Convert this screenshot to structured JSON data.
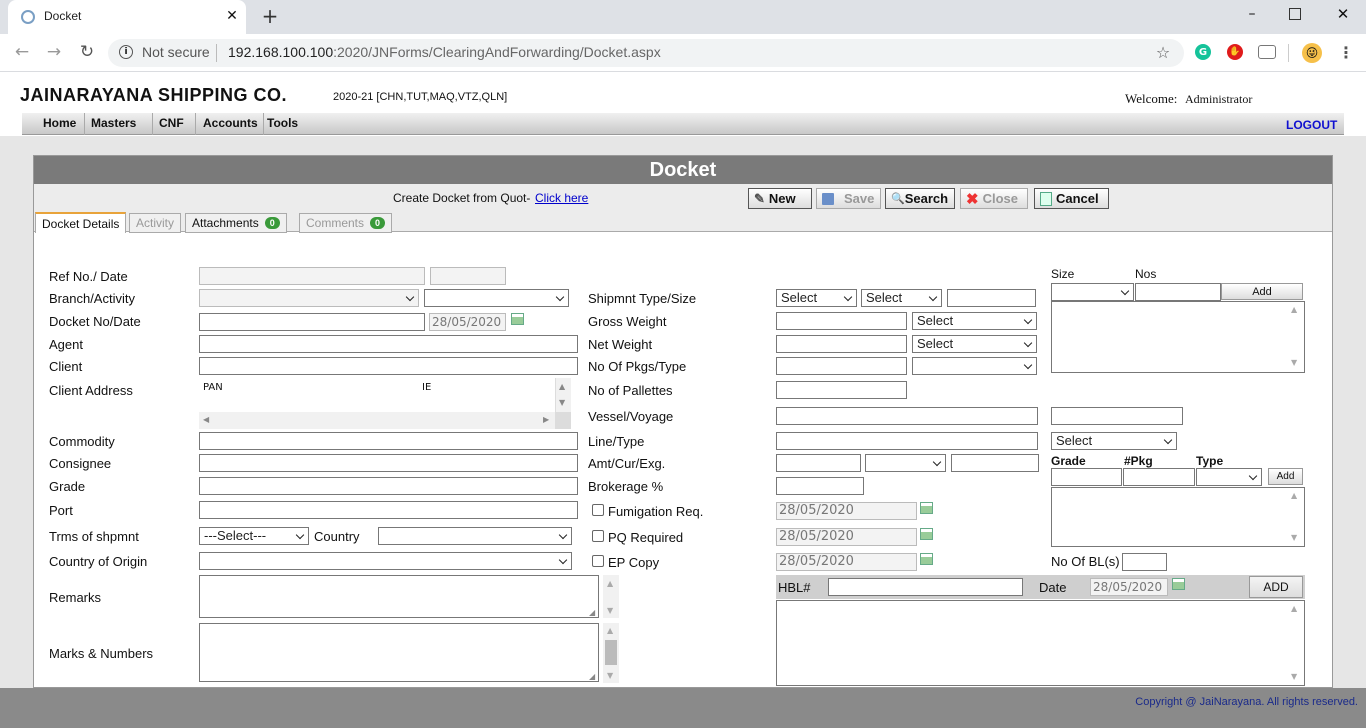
{
  "browser": {
    "tab_title": "Docket",
    "security_label": "Not secure",
    "url_host": "192.168.100.100",
    "url_path": ":2020/JNForms/ClearingAndForwarding/Docket.aspx"
  },
  "header": {
    "company": "JAINARAYANA SHIPPING CO.",
    "year_info": "2020-21 [CHN,TUT,MAQ,VTZ,QLN]",
    "welcome_label": "Welcome:",
    "user": "Administrator",
    "logout": "LOGOUT"
  },
  "menu": [
    "Home",
    "Masters",
    "CNF",
    "Accounts",
    "Tools"
  ],
  "panel_title": "Docket",
  "toolbar": {
    "create_text": "Create Docket from Quot-",
    "create_link": "Click here",
    "new": "New",
    "save": "Save",
    "search": "Search",
    "close": "Close",
    "cancel": "Cancel"
  },
  "tabs": {
    "details": "Docket Details",
    "activity": "Activity",
    "attachments": "Attachments",
    "attachments_count": "0",
    "comments": "Comments",
    "comments_count": "0"
  },
  "form": {
    "ref_no_date": "Ref No./ Date",
    "branch_activity": "Branch/Activity",
    "docket_no_date": "Docket No/Date",
    "docket_date": "28/05/2020",
    "agent": "Agent",
    "client": "Client",
    "client_address": "Client Address",
    "pan": "PAN",
    "ie": "IE",
    "commodity": "Commodity",
    "consignee": "Consignee",
    "grade": "Grade",
    "port": "Port",
    "terms_of_shipment": "Trms of shpmnt",
    "terms_select": "---Select---",
    "country": "Country",
    "country_of_origin": "Country of Origin",
    "remarks": "Remarks",
    "marks_numbers": "Marks & Numbers",
    "shipment_type_size": "Shipmnt Type/Size",
    "select": "Select",
    "gross_weight": "Gross Weight",
    "net_weight": "Net Weight",
    "pkgs_type": "No Of Pkgs/Type",
    "pallettes": "No of Pallettes",
    "vessel_voyage": "Vessel/Voyage",
    "line_type": "Line/Type",
    "amt_cur_exg": "Amt/Cur/Exg.",
    "brokerage": "Brokerage %",
    "fumigation": "Fumigation Req.",
    "pq_required": "PQ Required",
    "ep_copy": "EP Copy",
    "fumigation_date": "28/05/2020",
    "pq_date": "28/05/2020",
    "ep_date": "28/05/2020",
    "size": "Size",
    "nos": "Nos",
    "add": "Add",
    "grade_col": "Grade",
    "pkg_col": "#Pkg",
    "type_col": "Type",
    "no_of_bls": "No Of BL(s)",
    "hbl": "HBL#",
    "date": "Date",
    "hbl_date": "28/05/2020",
    "add_caps": "ADD"
  },
  "footer": "Copyright @ JaiNarayana. All rights reserved."
}
